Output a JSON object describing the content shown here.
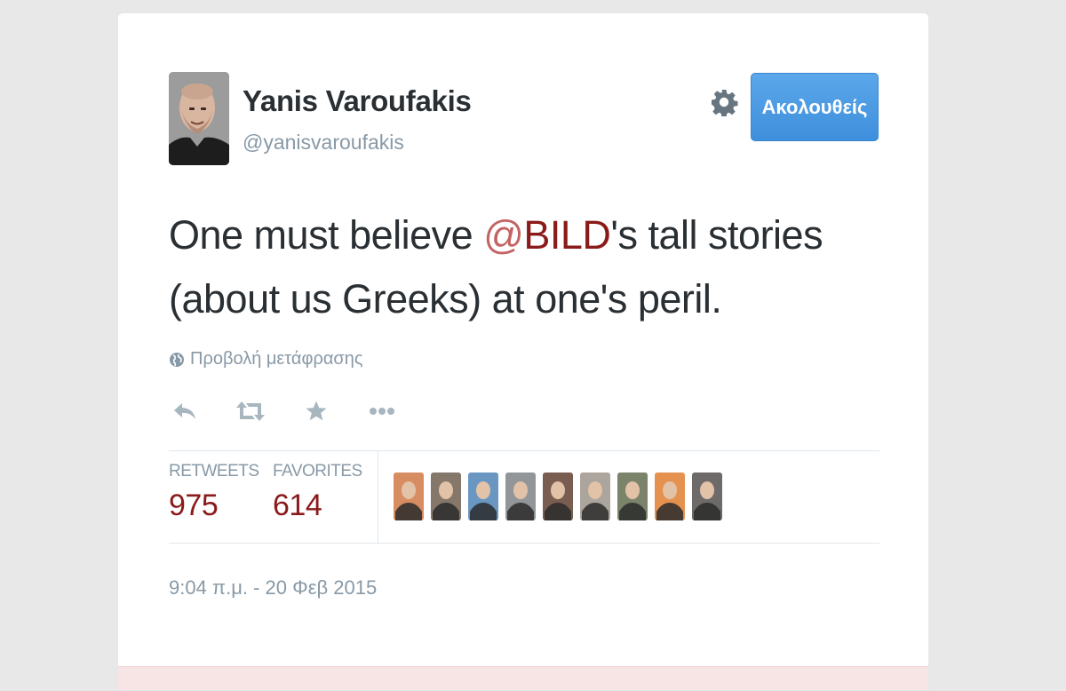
{
  "user": {
    "name": "Yanis Varoufakis",
    "handle": "@yanisvaroufakis",
    "avatar_icon": "profile-photo"
  },
  "follow_button": {
    "label": "Ακολουθείς",
    "color": "#3e8fdc"
  },
  "settings_icon": "gear-icon",
  "tweet": {
    "text_before": "One must believe ",
    "mention_at": "@",
    "mention_name": "BILD",
    "text_after": "'s tall stories (about us Greeks) at one's peril.",
    "mention_color": "#8b1a1a"
  },
  "translate": {
    "label": "Προβολή μετάφρασης",
    "icon": "globe-icon"
  },
  "actions": [
    {
      "name": "reply",
      "icon": "reply-icon"
    },
    {
      "name": "retweet",
      "icon": "retweet-icon"
    },
    {
      "name": "favorite",
      "icon": "star-icon"
    },
    {
      "name": "more",
      "icon": "more-icon"
    }
  ],
  "stats": {
    "retweets_label": "RETWEETS",
    "retweets_value": "975",
    "favorites_label": "FAVORITES",
    "favorites_value": "614"
  },
  "favoriters": [
    {
      "icon": "user-avatar",
      "color": "#d0733f"
    },
    {
      "icon": "user-avatar",
      "color": "#6b5a4a"
    },
    {
      "icon": "user-avatar",
      "color": "#4a7fb5"
    },
    {
      "icon": "user-avatar",
      "color": "#7a7f82"
    },
    {
      "icon": "user-avatar",
      "color": "#5c3a2a"
    },
    {
      "icon": "user-avatar",
      "color": "#9a9288"
    },
    {
      "icon": "user-avatar",
      "color": "#5f6a4a"
    },
    {
      "icon": "user-avatar",
      "color": "#e07a2a"
    },
    {
      "icon": "user-avatar",
      "color": "#4d4a48"
    }
  ],
  "timestamp": "9:04 π.μ. - 20 Φεβ 2015"
}
